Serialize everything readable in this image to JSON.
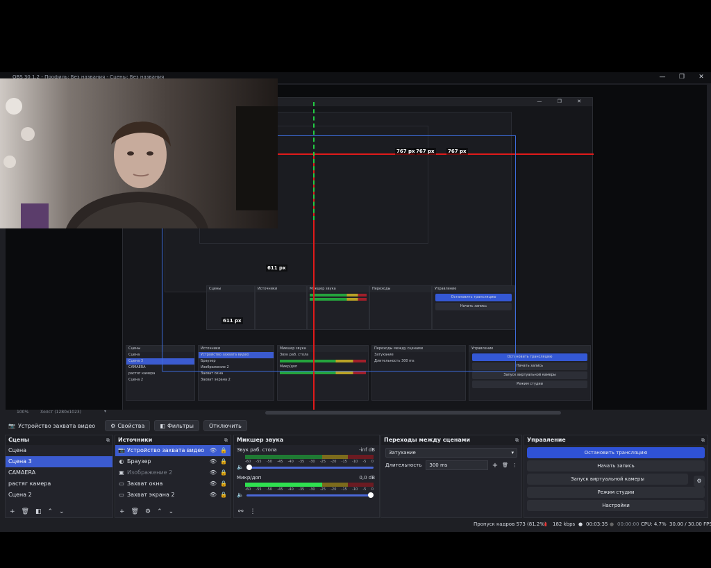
{
  "window": {
    "title": "OBS 30.1.2 - Профиль: Без названия - Сцены: Без названия"
  },
  "preview": {
    "measure_top": "767 px",
    "measure_top_mid": "767 px",
    "measure_small": "767 px",
    "measure_left": "611 px",
    "measure_left_mid": "611 px"
  },
  "zoom_bar": {
    "zoom": "100%",
    "canvas": "Холст (1280x1023)"
  },
  "props_bar": {
    "source_name": "Устройство захвата видео",
    "properties": "Свойства",
    "filters": "Фильтры",
    "disable": "Отключить"
  },
  "scenes": {
    "title": "Сцены",
    "items": [
      "Сцена",
      "Сцена 3",
      "CAMAERA",
      "растяг камера",
      "Сцена 2"
    ],
    "selected": 1
  },
  "sources": {
    "title": "Источники",
    "items": [
      {
        "name": "Устройство захвата видео",
        "icon": "camera-icon"
      },
      {
        "name": "Браузер",
        "icon": "globe-icon"
      },
      {
        "name": "Изображение 2",
        "icon": "image-icon"
      },
      {
        "name": "Захват окна",
        "icon": "window-icon"
      },
      {
        "name": "Захват экрана 2",
        "icon": "monitor-icon"
      }
    ],
    "selected": 0
  },
  "mixer": {
    "title": "Микшер звука",
    "channels": [
      {
        "name": "Звук раб. стола",
        "db": "-inf dB",
        "level": 0.0
      },
      {
        "name": "Микр/доп",
        "db": "0,0 dB",
        "level": 0.6
      }
    ],
    "scale": [
      "-60",
      "-55",
      "-50",
      "-45",
      "-40",
      "-35",
      "-30",
      "-25",
      "-20",
      "-15",
      "-10",
      "-5",
      "0"
    ]
  },
  "transitions": {
    "title": "Переходы между сценами",
    "type": "Затухание",
    "duration_label": "Длительность",
    "duration_value": "300 ms"
  },
  "controls": {
    "title": "Управление",
    "stop_stream": "Остановить трансляцию",
    "start_record": "Начать запись",
    "virtual_cam": "Запуск виртуальной камеры",
    "studio_mode": "Режим студии",
    "settings": "Настройки"
  },
  "status": {
    "dropped": "Пропуск кадров 573 (81.2%)",
    "bitrate": "182 kbps",
    "stream_time": "00:03:35",
    "record_time": "00:00:00",
    "cpu": "CPU: 4.7%",
    "fps": "30.00 / 30.00 FPS"
  },
  "colors": {
    "accent": "#3b5bd0",
    "red_guide": "#e11a1a",
    "green_guide": "#22cc44",
    "bg": "#1e1f24"
  }
}
